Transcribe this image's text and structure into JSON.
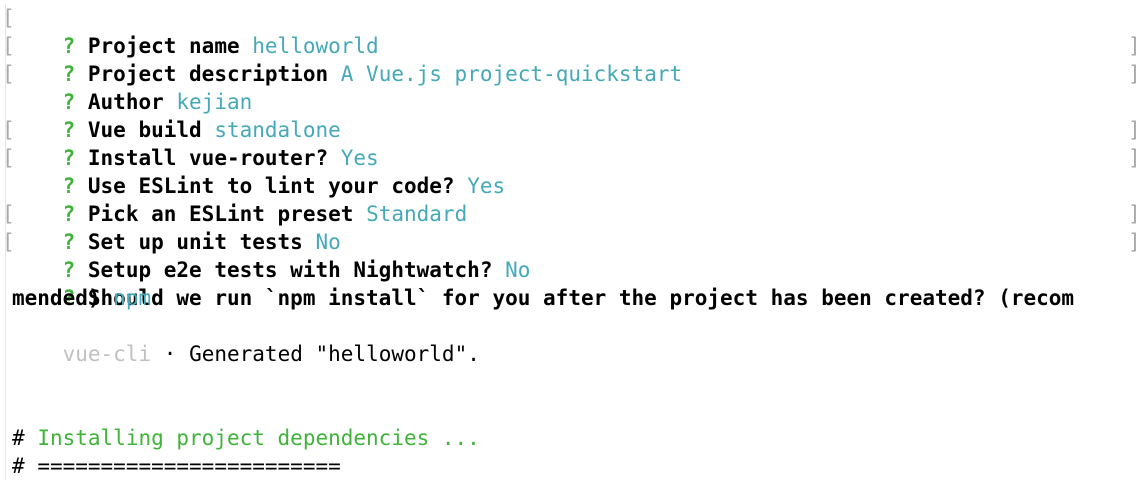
{
  "prompts": [
    {
      "question": "Project name",
      "answer": "helloworld",
      "bracket_left": "[",
      "bracket_right": ""
    },
    {
      "question": "Project description",
      "answer": "A Vue.js project-quickstart",
      "bracket_left": "[",
      "bracket_right": "]"
    },
    {
      "question": "Author",
      "answer": "kejian",
      "bracket_left": "[",
      "bracket_right": "]"
    },
    {
      "question": "Vue build",
      "answer": "standalone",
      "bracket_left": "",
      "bracket_right": ""
    },
    {
      "question": "Install vue-router?",
      "answer": "Yes",
      "bracket_left": "[",
      "bracket_right": "]"
    },
    {
      "question": "Use ESLint to lint your code?",
      "answer": "Yes",
      "bracket_left": "[",
      "bracket_right": "]"
    },
    {
      "question": "Pick an ESLint preset",
      "answer": "Standard",
      "bracket_left": "",
      "bracket_right": ""
    },
    {
      "question": "Set up unit tests",
      "answer": "No",
      "bracket_left": "[",
      "bracket_right": "]"
    },
    {
      "question": "Setup e2e tests with Nightwatch?",
      "answer": "No",
      "bracket_left": "[",
      "bracket_right": "]"
    },
    {
      "question": "Should we run `npm install` for you after the project has been created? (recom",
      "answer": "",
      "bracket_left": "",
      "bracket_right": ""
    }
  ],
  "prompt_marker": "?",
  "wrap_line": {
    "question": "mended)",
    "answer": "npm"
  },
  "generated": {
    "tool": "vue-cli",
    "separator": "·",
    "message": "Generated \"helloworld\"."
  },
  "install": {
    "hash": "#",
    "heading": "Installing project dependencies ...",
    "rule": "========================"
  },
  "colors": {
    "marker": "#3fb33a",
    "answer": "#45a9b9",
    "muted": "#c0c0c0",
    "text": "#000000"
  }
}
